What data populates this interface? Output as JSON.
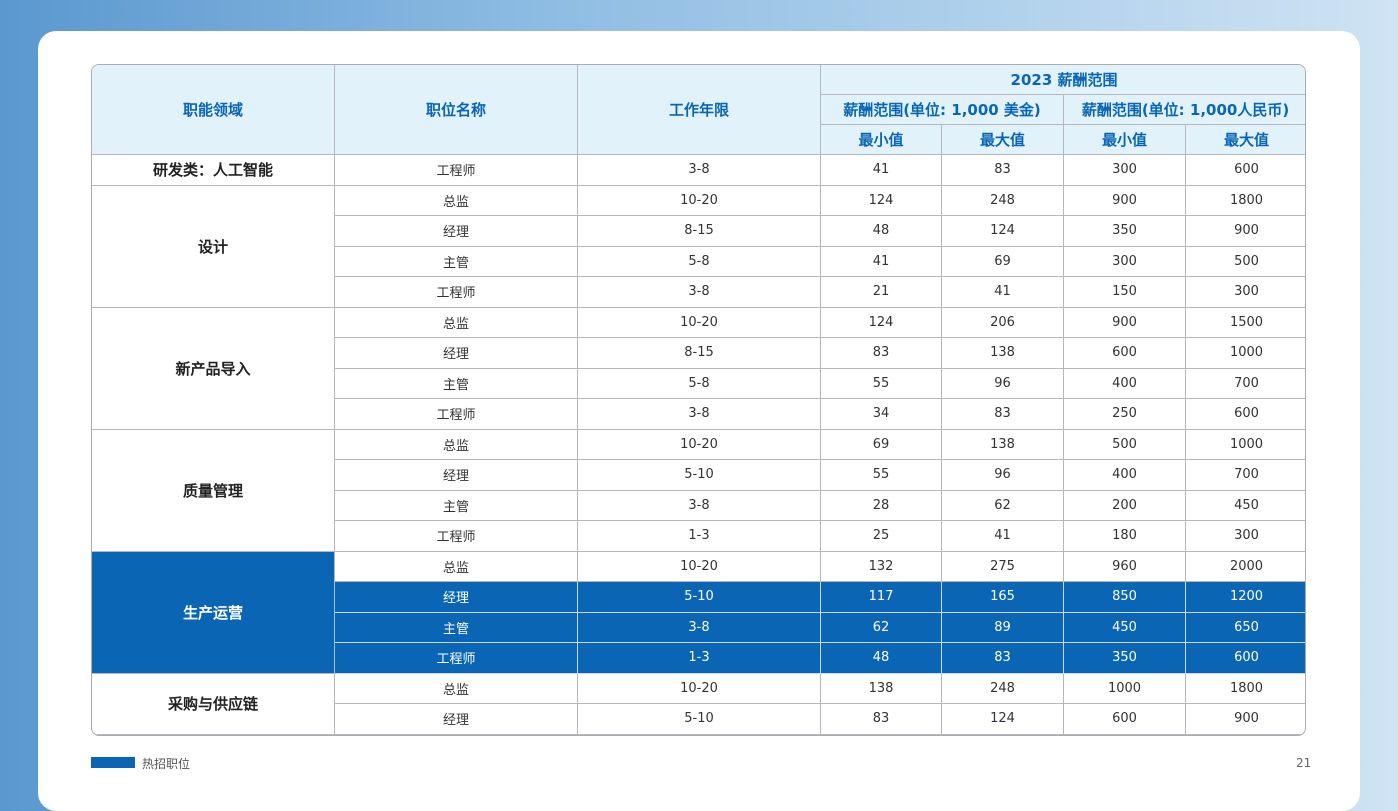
{
  "header": {
    "col_function": "职能领域",
    "col_position": "职位名称",
    "col_years": "工作年限",
    "group_title": "2023  薪酬范围",
    "usd_group": "薪酬范围(单位: 1,000  美金)",
    "rmb_group": "薪酬范围(单位: 1,000人民币)",
    "min_label": "最小值",
    "max_label": "最大值"
  },
  "categories": [
    "研发类：人工智能",
    "设计",
    "新产品导入",
    "质量管理",
    "生产运营",
    "采购与供应链"
  ],
  "rows": [
    {
      "position": "工程师",
      "years": "3-8",
      "usd_min": "41",
      "usd_max": "83",
      "rmb_min": "300",
      "rmb_max": "600"
    },
    {
      "position": "总监",
      "years": "10-20",
      "usd_min": "124",
      "usd_max": "248",
      "rmb_min": "900",
      "rmb_max": "1800"
    },
    {
      "position": "经理",
      "years": "8-15",
      "usd_min": "48",
      "usd_max": "124",
      "rmb_min": "350",
      "rmb_max": "900"
    },
    {
      "position": "主管",
      "years": "5-8",
      "usd_min": "41",
      "usd_max": "69",
      "rmb_min": "300",
      "rmb_max": "500"
    },
    {
      "position": "工程师",
      "years": "3-8",
      "usd_min": "21",
      "usd_max": "41",
      "rmb_min": "150",
      "rmb_max": "300"
    },
    {
      "position": "总监",
      "years": "10-20",
      "usd_min": "124",
      "usd_max": "206",
      "rmb_min": "900",
      "rmb_max": "1500"
    },
    {
      "position": "经理",
      "years": "8-15",
      "usd_min": "83",
      "usd_max": "138",
      "rmb_min": "600",
      "rmb_max": "1000"
    },
    {
      "position": "主管",
      "years": "5-8",
      "usd_min": "55",
      "usd_max": "96",
      "rmb_min": "400",
      "rmb_max": "700"
    },
    {
      "position": "工程师",
      "years": "3-8",
      "usd_min": "34",
      "usd_max": "83",
      "rmb_min": "250",
      "rmb_max": "600"
    },
    {
      "position": "总监",
      "years": "10-20",
      "usd_min": "69",
      "usd_max": "138",
      "rmb_min": "500",
      "rmb_max": "1000"
    },
    {
      "position": "经理",
      "years": "5-10",
      "usd_min": "55",
      "usd_max": "96",
      "rmb_min": "400",
      "rmb_max": "700"
    },
    {
      "position": "主管",
      "years": "3-8",
      "usd_min": "28",
      "usd_max": "62",
      "rmb_min": "200",
      "rmb_max": "450"
    },
    {
      "position": "工程师",
      "years": "1-3",
      "usd_min": "25",
      "usd_max": "41",
      "rmb_min": "180",
      "rmb_max": "300"
    },
    {
      "position": "总监",
      "years": "10-20",
      "usd_min": "132",
      "usd_max": "275",
      "rmb_min": "960",
      "rmb_max": "2000"
    },
    {
      "position": "经理",
      "years": "5-10",
      "usd_min": "117",
      "usd_max": "165",
      "rmb_min": "850",
      "rmb_max": "1200"
    },
    {
      "position": "主管",
      "years": "3-8",
      "usd_min": "62",
      "usd_max": "89",
      "rmb_min": "450",
      "rmb_max": "650"
    },
    {
      "position": "工程师",
      "years": "1-3",
      "usd_min": "48",
      "usd_max": "83",
      "rmb_min": "350",
      "rmb_max": "600"
    },
    {
      "position": "总监",
      "years": "10-20",
      "usd_min": "138",
      "usd_max": "248",
      "rmb_min": "1000",
      "rmb_max": "1800"
    },
    {
      "position": "经理",
      "years": "5-10",
      "usd_min": "83",
      "usd_max": "124",
      "rmb_min": "600",
      "rmb_max": "900"
    }
  ],
  "footer": {
    "label": "热招职位",
    "page_number": "21"
  },
  "colors": {
    "accent": "#0a66b5",
    "header_bg": "#e1f2fb"
  }
}
